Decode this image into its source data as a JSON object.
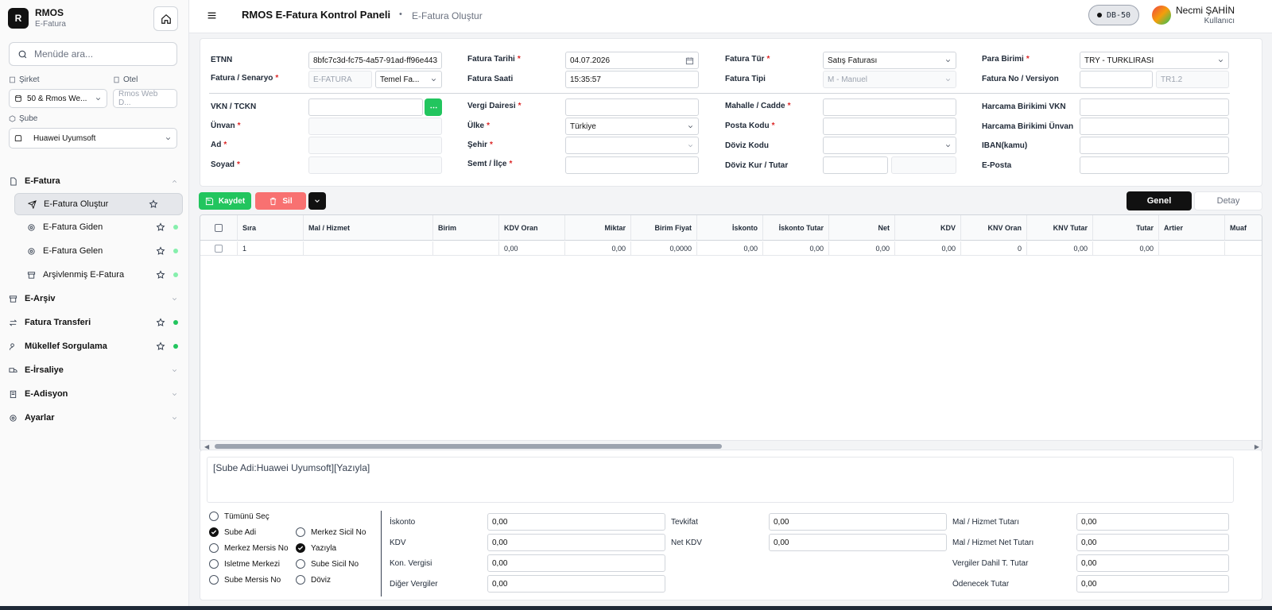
{
  "brand": {
    "letter": "R",
    "title": "RMOS",
    "subtitle": "E-Fatura"
  },
  "sidebar": {
    "search_placeholder": "Menüde ara...",
    "company_label": "Şirket",
    "company_value": "50 & Rmos We...",
    "hotel_label": "Otel",
    "hotel_value": "Rmos Web D...",
    "branch_label": "Şube",
    "branch_value": "Huawei Uyumsoft",
    "items": [
      {
        "label": "E-Fatura"
      },
      {
        "label": "E-Fatura Oluştur"
      },
      {
        "label": "E-Fatura Giden"
      },
      {
        "label": "E-Fatura Gelen"
      },
      {
        "label": "Arşivlenmiş E-Fatura"
      },
      {
        "label": "E-Arşiv"
      },
      {
        "label": "Fatura Transferi"
      },
      {
        "label": "Mükellef Sorgulama"
      },
      {
        "label": "E-İrsaliye"
      },
      {
        "label": "E-Adisyon"
      },
      {
        "label": "Ayarlar"
      }
    ]
  },
  "header": {
    "title": "RMOS E-Fatura Kontrol Paneli",
    "separator": "•",
    "subtitle": "E-Fatura Oluştur",
    "db_badge": "DB-50",
    "user_name": "Necmi ŞAHİN",
    "user_role": "Kullanıcı"
  },
  "form": {
    "etnn_label": "ETNN",
    "etnn_value": "8bfc7c3d-fc75-4a57-91ad-ff96e443",
    "senaryo_label": "Fatura / Senaryo",
    "senaryo_value1": "E-FATURA",
    "senaryo_value2": "Temel Fa...",
    "tarih_label": "Fatura Tarihi",
    "tarih_value": "04.07.2026",
    "saat_label": "Fatura Saati",
    "saat_value": "15:35:57",
    "tur_label": "Fatura Tür",
    "tur_value": "Satış Faturası",
    "tip_label": "Fatura Tipi",
    "tip_value": "M - Manuel",
    "para_label": "Para Birimi",
    "para_value": "TRY - TURKLIRASI",
    "no_label": "Fatura No / Versiyon",
    "no_value": "",
    "versiyon_value": "TR1.2",
    "vkn_label": "VKN / TCKN",
    "unvan_label": "Ünvan",
    "ad_label": "Ad",
    "soyad_label": "Soyad",
    "vergi_label": "Vergi Dairesi",
    "ulke_label": "Ülke",
    "ulke_value": "Türkiye",
    "sehir_label": "Şehir",
    "semt_label": "Semt / İlçe",
    "mahalle_label": "Mahalle / Cadde",
    "posta_label": "Posta Kodu",
    "doviz_label": "Döviz Kodu",
    "kur_label": "Döviz Kur / Tutar",
    "hvkn_label": "Harcama Birikimi VKN",
    "hunvan_label": "Harcama Birikimi Ünvan",
    "iban_label": "IBAN(kamu)",
    "eposta_label": "E-Posta"
  },
  "toolbar": {
    "save": "Kaydet",
    "delete": "Sil",
    "tab_general": "Genel",
    "tab_detail": "Detay"
  },
  "grid": {
    "headers": [
      "Sıra",
      "Mal / Hizmet",
      "Birim",
      "KDV Oran",
      "Miktar",
      "Birim Fiyat",
      "İskonto",
      "İskonto Tutar",
      "Net",
      "KDV",
      "KNV Oran",
      "KNV Tutar",
      "Tutar",
      "Artier",
      "Muaf"
    ],
    "row": [
      "1",
      "",
      "",
      "0,00",
      "0,00",
      "0,0000",
      "0,00",
      "0,00",
      "0,00",
      "0,00",
      "0",
      "0,00",
      "0,00",
      "",
      ""
    ]
  },
  "note": "[Sube Adi:Huawei Uyumsoft][Yazıyla]",
  "options": {
    "select_all": "Tümünü Seç",
    "sube_adi": "Sube Adi",
    "merkez_mersis": "Merkez Mersis No",
    "isletme": "Isletme Merkezi",
    "sube_mersis": "Sube Mersis No",
    "merkez_sicil": "Merkez Sicil No",
    "yaziyla": "Yazıyla",
    "sube_sicil": "Sube Sicil No",
    "doviz": "Döviz"
  },
  "totals": {
    "iskonto_label": "İskonto",
    "iskonto": "0,00",
    "kdv_label": "KDV",
    "kdv": "0,00",
    "kon_label": "Kon. Vergisi",
    "kon": "0,00",
    "diger_label": "Diğer Vergiler",
    "diger": "0,00",
    "tevkifat_label": "Tevkifat",
    "tevkifat": "0,00",
    "netkdv_label": "Net KDV",
    "netkdv": "0,00",
    "mal_label": "Mal / Hizmet Tutarı",
    "mal": "0,00",
    "malnet_label": "Mal / Hizmet Net Tutarı",
    "malnet": "0,00",
    "vergiler_label": "Vergiler Dahil T. Tutar",
    "vergiler": "0,00",
    "odenecek_label": "Ödenecek Tutar",
    "odenecek": "0,00"
  },
  "colors": {
    "accent_green": "#22c55e",
    "danger": "#f87171",
    "dark": "#111111"
  }
}
